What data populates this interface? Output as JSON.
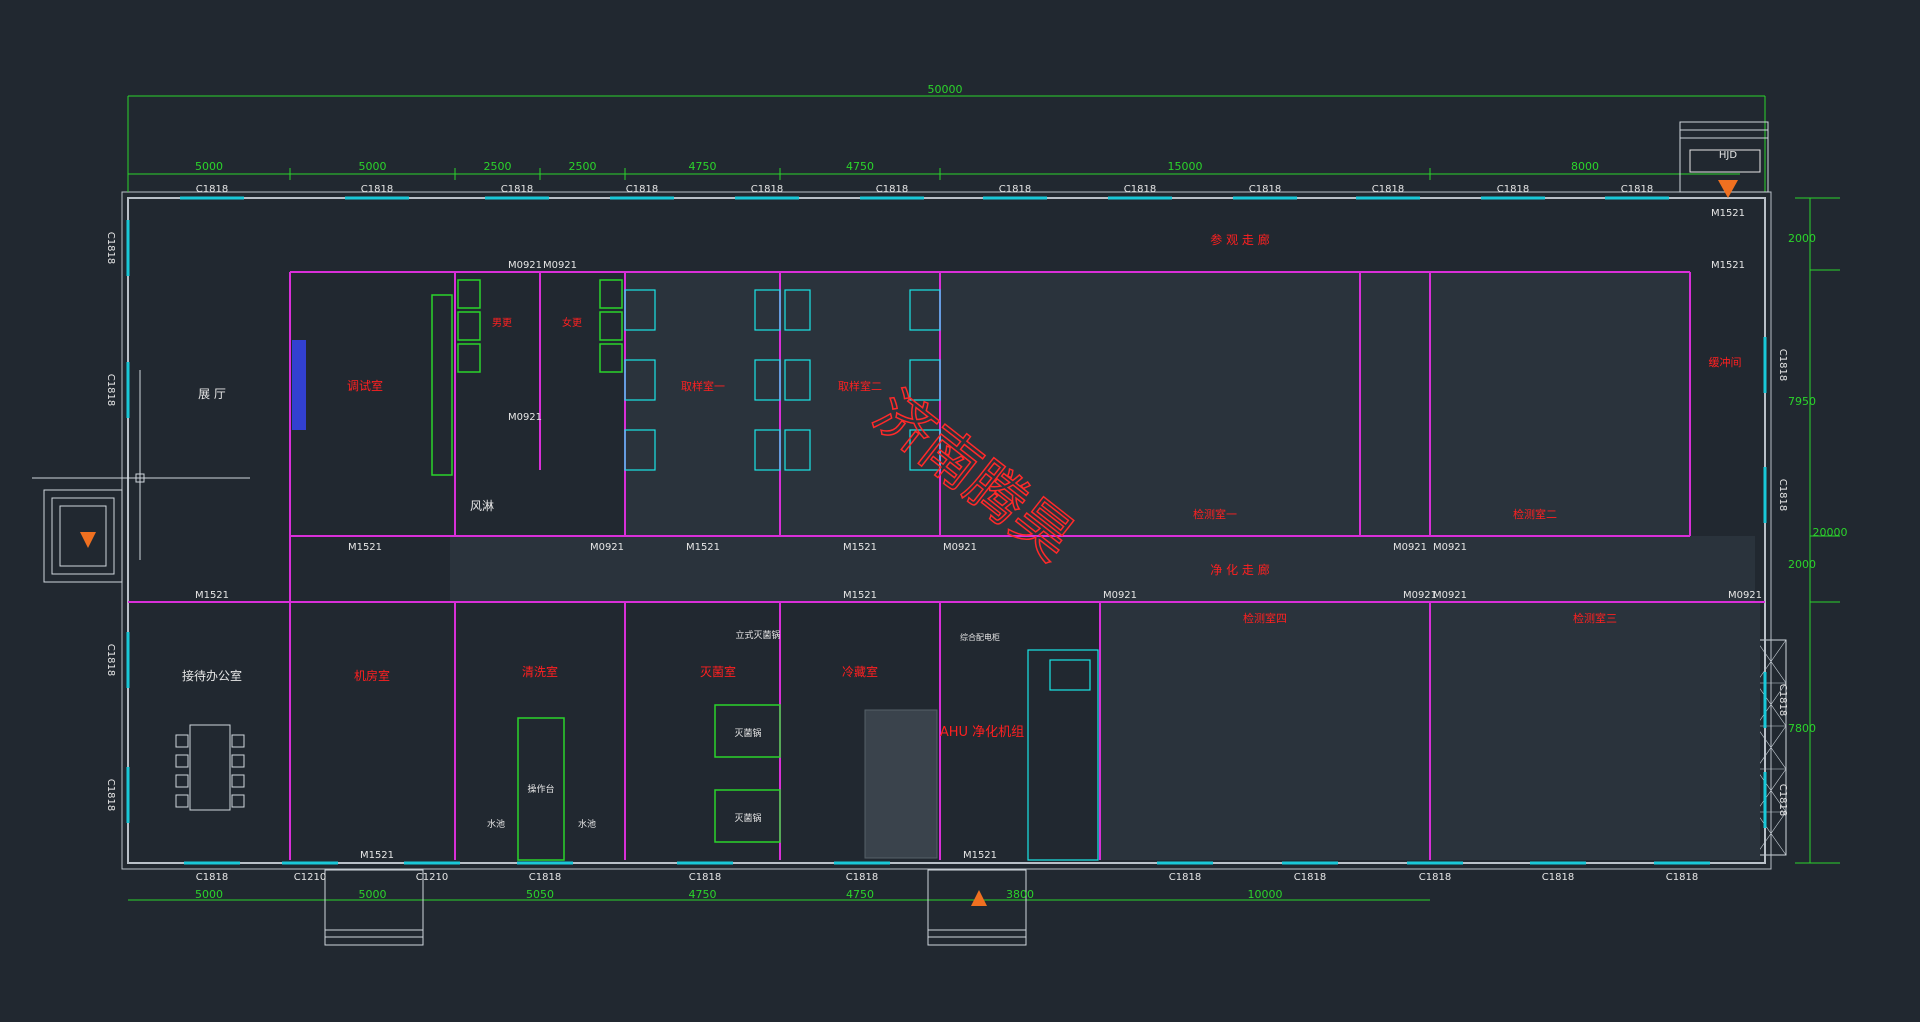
{
  "colors": {
    "background": "#212830",
    "wall": "#b9c0c8",
    "partition": "#d92fd9",
    "window": "#19c8d8",
    "dimension": "#2bd42b",
    "room_label": "#ff2020",
    "equipment": "#19e6e6",
    "rack": "#cfd6dd",
    "label_white": "#e6e6e6",
    "watermark": "#ff2a2a"
  },
  "dimensions": {
    "overall_top": "50000",
    "top_segments": [
      "5000",
      "5000",
      "2500",
      "2500",
      "4750",
      "4750",
      "15000",
      "8000"
    ],
    "bottom_segments": [
      "5000",
      "5000",
      "5050",
      "4750",
      "4750",
      "3800",
      "10000"
    ],
    "right_overall": "20000",
    "right_segments": [
      "2000",
      "7950",
      "2000",
      "7800"
    ]
  },
  "windows": {
    "top": [
      "C1818",
      "C1818",
      "C1818",
      "C1818",
      "C1818",
      "C1818",
      "C1818",
      "C1818",
      "C1818",
      "C1818",
      "C1818",
      "C1818"
    ],
    "bottom": [
      "C1818",
      "C1210",
      "C1210",
      "C1818",
      "C1818",
      "C1818",
      "C1818",
      "C1818",
      "C1818",
      "C1818",
      "C1818"
    ],
    "left": [
      "C1818",
      "C1818",
      "C1818",
      "C1818"
    ],
    "right": [
      "C1818",
      "C1818",
      "C1818",
      "C1818"
    ],
    "top_right_label": "HJD"
  },
  "doors": {
    "m1521": "M1521",
    "m0921": "M0921"
  },
  "rooms": {
    "hall": "展 厅",
    "reception_office": "接待办公室",
    "control_room": "调试室",
    "visit_corridor": "参 观 走 廊",
    "clean_corridor": "净 化 走 廊",
    "men_wc": "男更",
    "women_wc": "女更",
    "sample_1": "取样室一",
    "sample_2": "取样室二",
    "test_room_1": "检测室一",
    "test_room_2": "检测室二",
    "test_room_3": "检测室三",
    "test_room_4": "检测室四",
    "lab_left": "机房室",
    "lab_mid": "清洗室",
    "sterilize": "灭菌室",
    "cold": "冷藏室",
    "buffer": "缓冲间",
    "ahu": "AHU 净化机组",
    "air_shower": "风淋",
    "side_room": "综合配电柜"
  },
  "equipment": {
    "sterilizer": "灭菌锅",
    "vertical_sterilizer": "立式灭菌锅",
    "table": "操作台",
    "sink": "水池"
  },
  "watermark": "济南腾昊"
}
